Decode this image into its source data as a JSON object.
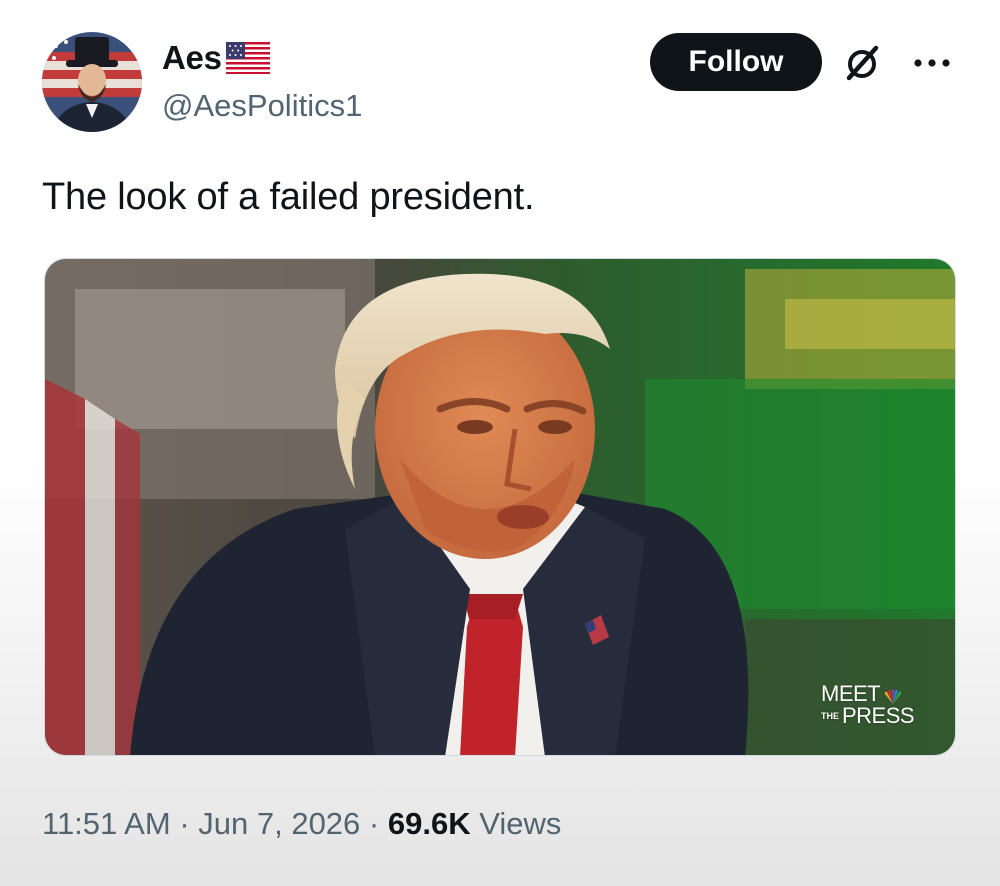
{
  "author": {
    "display_name": "Aes",
    "handle": "@AesPolitics1",
    "avatar_icon": "avatar-top-hat-man",
    "badge_icon": "us-flag-icon"
  },
  "actions": {
    "follow_label": "Follow",
    "grok_icon": "grok-icon",
    "more_icon": "more-icon"
  },
  "tweet": {
    "text": "The look of a failed president."
  },
  "media": {
    "watermark": {
      "line1": "MEET",
      "small": "THE",
      "line2": "PRESS"
    }
  },
  "meta": {
    "time": "11:51 AM",
    "separator": "·",
    "date": "Jun 7, 2026",
    "views_count": "69.6K",
    "views_label": "Views"
  },
  "colors": {
    "text_primary": "#0f1419",
    "text_secondary": "#536471",
    "button_bg": "#0f1419",
    "button_text": "#ffffff"
  }
}
